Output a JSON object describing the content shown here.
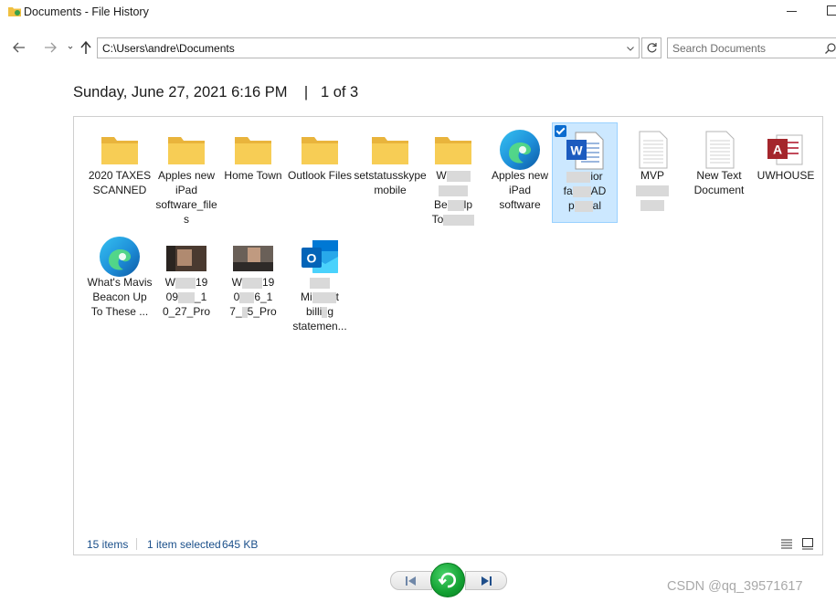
{
  "window": {
    "title": "Documents - File History"
  },
  "navigation": {
    "address": "C:\\Users\\andre\\Documents",
    "search_placeholder": "Search Documents"
  },
  "snapshot": {
    "date": "Sunday, June 27, 2021 6:16 PM",
    "separator": "|",
    "position": "1 of 3"
  },
  "items": [
    {
      "label": "2020 TAXES SCANNED",
      "icon": "folder-icon"
    },
    {
      "label": "Apples new iPad software_files",
      "icon": "folder-icon"
    },
    {
      "label": "Home Town",
      "icon": "folder-icon"
    },
    {
      "label": "Outlook Files",
      "icon": "folder-icon"
    },
    {
      "label": "setstatusskypemobile",
      "icon": "folder-icon"
    },
    {
      "label_parts": [
        "W",
        "Be",
        "lp",
        "To"
      ],
      "icon": "folder-icon"
    },
    {
      "label": "Apples new iPad software",
      "icon": "edge-icon"
    },
    {
      "label_parts": [
        "ior",
        "fa",
        "AD",
        "p",
        "al"
      ],
      "icon": "word-icon",
      "selected": true
    },
    {
      "label_parts": [
        "MVP"
      ],
      "icon": "text-document-icon"
    },
    {
      "label": "New Text Document",
      "icon": "text-document-icon"
    },
    {
      "label": "UWHOUSE",
      "icon": "access-icon"
    },
    {
      "label": "What's Mavis Beacon Up To These ...",
      "icon": "edge-icon"
    },
    {
      "label_parts": [
        "W",
        "19",
        "09",
        "_1",
        "0_27_Pro"
      ],
      "icon": "video-thumbnail-icon"
    },
    {
      "label_parts": [
        "W",
        "19",
        "0",
        "6_1",
        "7_",
        "5_Pro"
      ],
      "icon": "video-thumbnail-icon"
    },
    {
      "label_parts": [
        "Mi",
        "t",
        "billi",
        "g",
        "statemen..."
      ],
      "icon": "outlook-icon"
    }
  ],
  "status": {
    "count": "15 items",
    "selected": "1 item selected",
    "size": "645 KB"
  },
  "watermark": "CSDN @qq_39571617",
  "colors": {
    "folder": "#f6c84f",
    "selection": "#cce8ff",
    "restore": "#12a032"
  }
}
